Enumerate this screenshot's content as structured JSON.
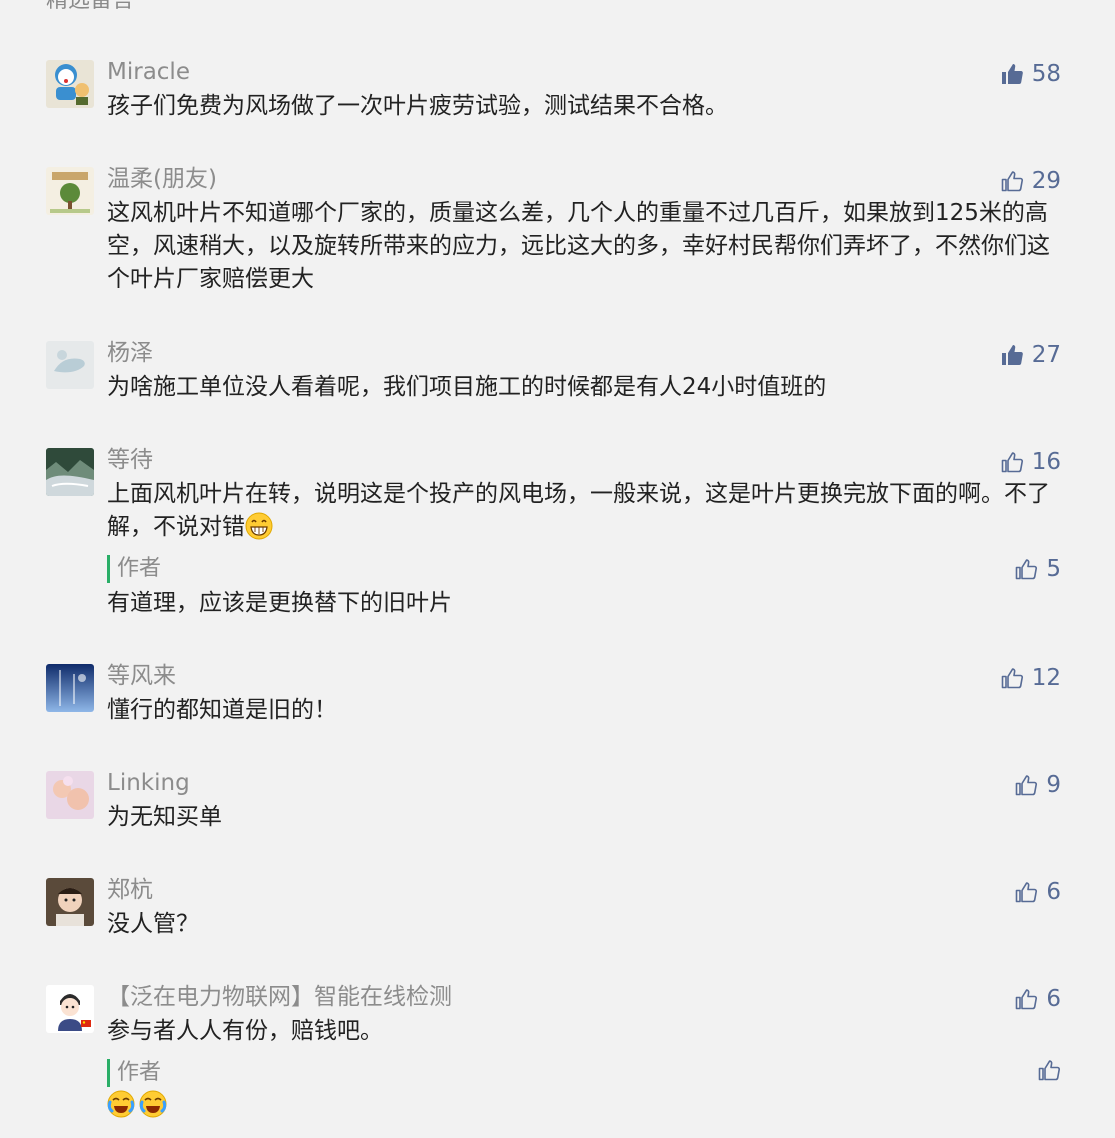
{
  "section_title": "精选留言",
  "comments": [
    {
      "name": "Miracle",
      "text": "孩子们免费为风场做了一次叶片疲劳试验，测试结果不合格。",
      "likes": "58",
      "liked": true
    },
    {
      "name": "温柔(朋友)",
      "text": "这风机叶片不知道哪个厂家的，质量这么差，几个人的重量不过几百斤，如果放到125米的高空，风速稍大，以及旋转所带来的应力，远比这大的多，幸好村民帮你们弄坏了，不然你们这个叶片厂家赔偿更大",
      "likes": "29",
      "liked": false
    },
    {
      "name": "杨泽",
      "text": "为啥施工单位没人看着呢，我们项目施工的时候都是有人24小时值班的",
      "likes": "27",
      "liked": true
    },
    {
      "name": "等待",
      "text": "上面风机叶片在转，说明这是个投产的风电场，一般来说，这是叶片更换完放下面的啊。不了解，不说对错",
      "likes": "16",
      "liked": false,
      "emoji": "grin-emoji",
      "reply": {
        "author": "作者",
        "text": "有道理，应该是更换替下的旧叶片",
        "likes": "5"
      }
    },
    {
      "name": "等风来",
      "text": "懂行的都知道是旧的！",
      "likes": "12",
      "liked": false
    },
    {
      "name": "Linking",
      "text": "为无知买单",
      "likes": "9",
      "liked": false
    },
    {
      "name": "郑杭",
      "text": "没人管？",
      "likes": "6",
      "liked": false
    },
    {
      "name": "【泛在电力物联网】智能在线检测",
      "text": "参与者人人有份，赔钱吧。",
      "likes": "6",
      "liked": false,
      "reply": {
        "author": "作者",
        "text": "",
        "likes": "",
        "emojis": [
          "laugh-cry-emoji",
          "laugh-cry-emoji"
        ]
      }
    }
  ],
  "colors": {
    "link": "#576b95",
    "author_bar": "#2aae67",
    "background": "#f2f2f2"
  }
}
